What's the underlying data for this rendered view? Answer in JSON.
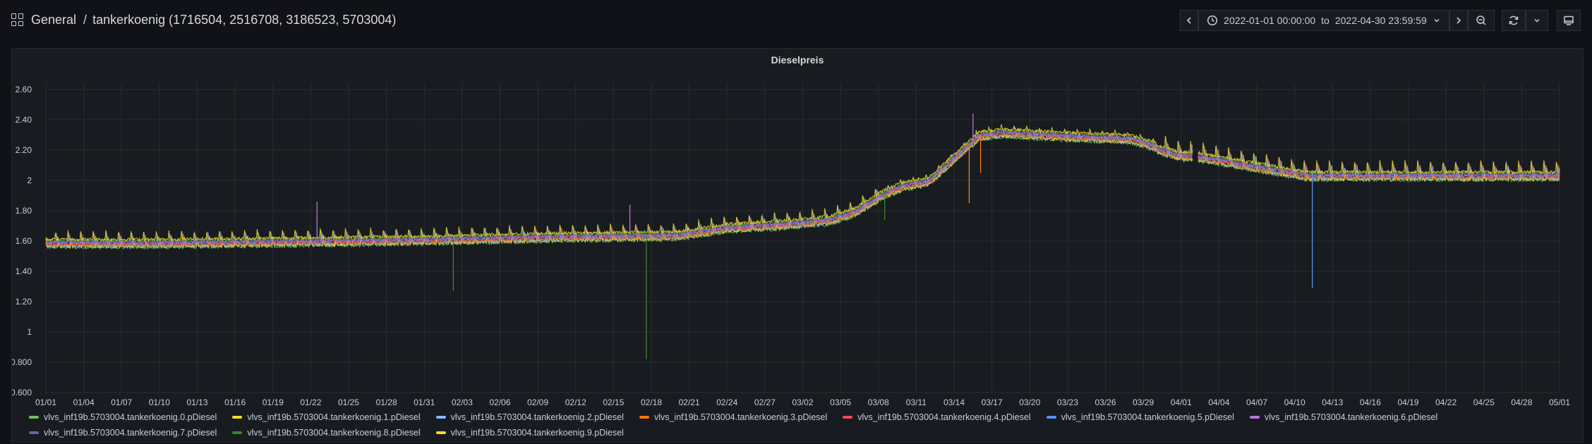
{
  "breadcrumb": {
    "folder": "General",
    "separator": "/",
    "dashboard": "tankerkoenig (1716504, 2516708, 3186523, 5703004)"
  },
  "time_range": {
    "from": "2022-01-01 00:00:00",
    "joiner": "to",
    "to": "2022-04-30 23:59:59"
  },
  "icons": {
    "dashboards": "grid-icon",
    "back": "chevron-left-icon",
    "clock": "clock-icon",
    "caret": "chevron-down-icon",
    "forward": "chevron-right-icon",
    "zoom_out": "zoom-out-icon",
    "refresh": "refresh-icon",
    "refresh_menu": "chevron-down-icon",
    "tv": "monitor-icon"
  },
  "panel": {
    "title": "Dieselpreis"
  },
  "chart_data": {
    "type": "line",
    "title": "Dieselpreis",
    "xlabel": "",
    "ylabel": "",
    "ylim": [
      0.6,
      2.6
    ],
    "xlim": [
      "01/01",
      "05/01"
    ],
    "grid": true,
    "legend_position": "bottom",
    "y_ticks": [
      "0.600",
      "0.800",
      "1",
      "1.20",
      "1.40",
      "1.60",
      "1.80",
      "2",
      "2.20",
      "2.40",
      "2.60"
    ],
    "y_tick_values": [
      0.6,
      0.8,
      1.0,
      1.2,
      1.4,
      1.6,
      1.8,
      2.0,
      2.2,
      2.4,
      2.6
    ],
    "x_ticks": [
      "01/01",
      "01/04",
      "01/07",
      "01/10",
      "01/13",
      "01/16",
      "01/19",
      "01/22",
      "01/25",
      "01/28",
      "01/31",
      "02/03",
      "02/06",
      "02/09",
      "02/12",
      "02/15",
      "02/18",
      "02/21",
      "02/24",
      "02/27",
      "03/02",
      "03/05",
      "03/08",
      "03/11",
      "03/14",
      "03/17",
      "03/20",
      "03/23",
      "03/26",
      "03/29",
      "04/01",
      "04/04",
      "04/07",
      "04/10",
      "04/13",
      "04/16",
      "04/19",
      "04/22",
      "04/25",
      "04/28",
      "05/01"
    ],
    "trend_day": [
      0,
      10,
      20,
      30,
      40,
      50,
      54,
      58,
      62,
      64,
      66,
      68,
      70,
      72,
      74,
      76,
      80,
      86,
      90,
      91,
      100,
      110,
      120
    ],
    "trend_value": [
      1.6,
      1.6,
      1.61,
      1.62,
      1.64,
      1.65,
      1.7,
      1.72,
      1.75,
      1.8,
      1.9,
      1.97,
      2.0,
      2.15,
      2.3,
      2.32,
      2.3,
      2.28,
      2.18,
      2.18,
      2.05,
      2.05,
      2.05
    ],
    "gap_days": [
      90.9,
      91.3
    ],
    "spikes": [
      {
        "series": 8,
        "day": 32.3,
        "value": 1.27
      },
      {
        "series": 8,
        "day": 47.6,
        "value": 0.82
      },
      {
        "series": 3,
        "day": 73.2,
        "value": 1.85
      },
      {
        "series": 3,
        "day": 74.1,
        "value": 2.05
      },
      {
        "series": 5,
        "day": 100.4,
        "value": 1.29
      },
      {
        "series": 6,
        "day": 73.5,
        "value": 2.44
      },
      {
        "series": 8,
        "day": 66.5,
        "value": 1.74
      },
      {
        "series": 6,
        "day": 21.5,
        "value": 1.86
      },
      {
        "series": 6,
        "day": 46.3,
        "value": 1.84
      }
    ],
    "series": [
      {
        "name": "vlvs_inf19b.5703004.tankerkoenig.0.pDiesel",
        "color": "#73bf69"
      },
      {
        "name": "vlvs_inf19b.5703004.tankerkoenig.1.pDiesel",
        "color": "#fade2a"
      },
      {
        "name": "vlvs_inf19b.5703004.tankerkoenig.2.pDiesel",
        "color": "#8ab8ff"
      },
      {
        "name": "vlvs_inf19b.5703004.tankerkoenig.3.pDiesel",
        "color": "#ff780a"
      },
      {
        "name": "vlvs_inf19b.5703004.tankerkoenig.4.pDiesel",
        "color": "#f2495c"
      },
      {
        "name": "vlvs_inf19b.5703004.tankerkoenig.5.pDiesel",
        "color": "#5794f2"
      },
      {
        "name": "vlvs_inf19b.5703004.tankerkoenig.6.pDiesel",
        "color": "#b877d9"
      },
      {
        "name": "vlvs_inf19b.5703004.tankerkoenig.7.pDiesel",
        "color": "#705da0"
      },
      {
        "name": "vlvs_inf19b.5703004.tankerkoenig.8.pDiesel",
        "color": "#37872d"
      },
      {
        "name": "vlvs_inf19b.5703004.tankerkoenig.9.pDiesel",
        "color": "#fade2a"
      }
    ]
  }
}
